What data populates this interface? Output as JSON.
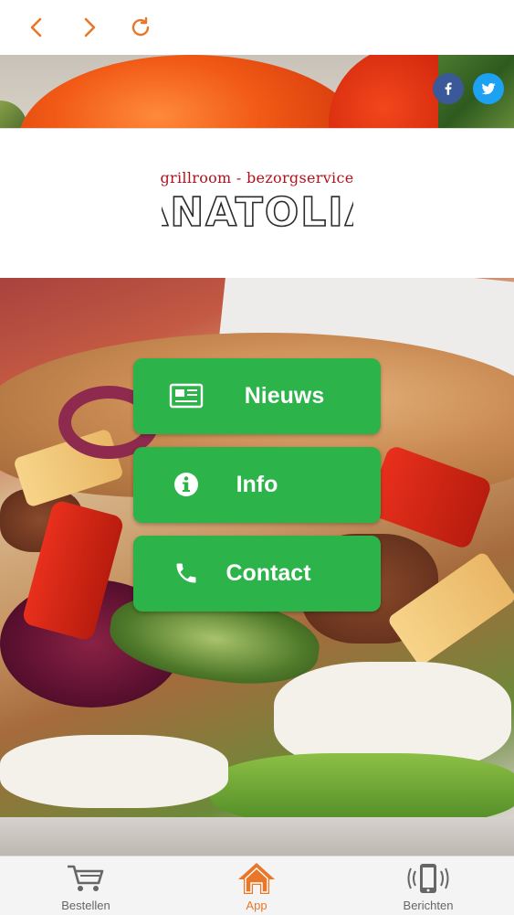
{
  "nav": {
    "back_icon": "chevron-left-icon",
    "forward_icon": "chevron-right-icon",
    "reload_icon": "reload-icon",
    "accent_color": "#e8772a"
  },
  "banner": {
    "social": [
      {
        "name": "facebook",
        "icon": "facebook-icon",
        "color": "#3b5998"
      },
      {
        "name": "twitter",
        "icon": "twitter-icon",
        "color": "#1da1f2"
      }
    ]
  },
  "logo": {
    "subtitle": "grillroom - bezorgservice",
    "title": "ANATOLIA",
    "subtitle_color": "#b0121c"
  },
  "menu": {
    "button_color": "#2cb34a",
    "items": [
      {
        "label": "Nieuws",
        "icon": "newspaper-icon"
      },
      {
        "label": "Info",
        "icon": "info-icon"
      },
      {
        "label": "Contact",
        "icon": "phone-icon"
      }
    ]
  },
  "tabbar": {
    "items": [
      {
        "label": "Bestellen",
        "icon": "cart-icon",
        "active": false
      },
      {
        "label": "App",
        "icon": "home-icon",
        "active": true
      },
      {
        "label": "Berichten",
        "icon": "phone-vibrate-icon",
        "active": false
      }
    ],
    "active_color": "#e8772a"
  }
}
